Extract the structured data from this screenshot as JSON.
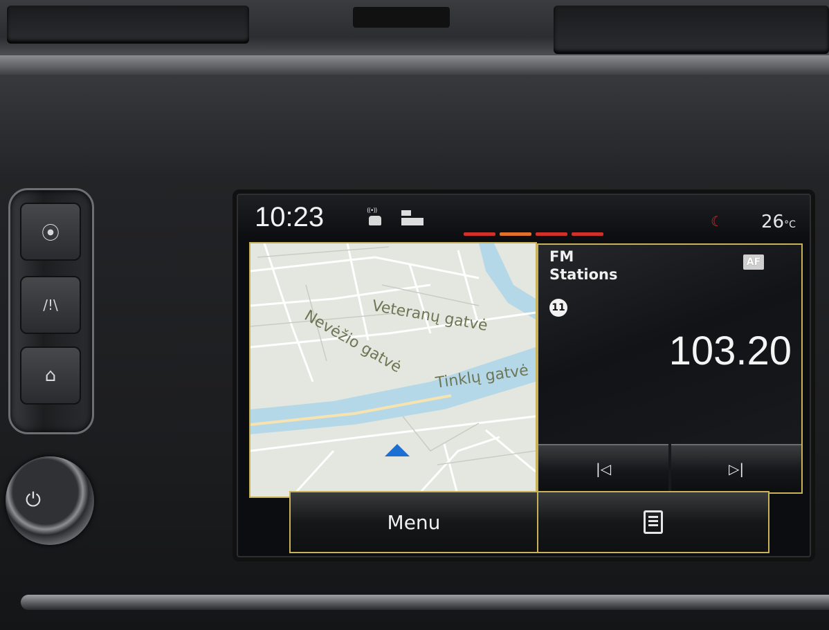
{
  "status": {
    "time": "10:23",
    "temperature": "26",
    "temperature_unit": "°C"
  },
  "map": {
    "streets": [
      "Veteranų gatvė",
      "Nevėžio gatvė",
      "Tinklų gatvė"
    ]
  },
  "radio": {
    "band": "FM",
    "title": "Stations",
    "af_label": "AF",
    "preset": "11",
    "frequency": "103.20",
    "prev_symbol": "|◁",
    "next_symbol": "▷|"
  },
  "bottom": {
    "menu_label": "Menu"
  },
  "colors": {
    "accent_border": "#c9b35a",
    "page_indicator": "#d0302a",
    "nav_arrow": "#1e6fd4"
  }
}
